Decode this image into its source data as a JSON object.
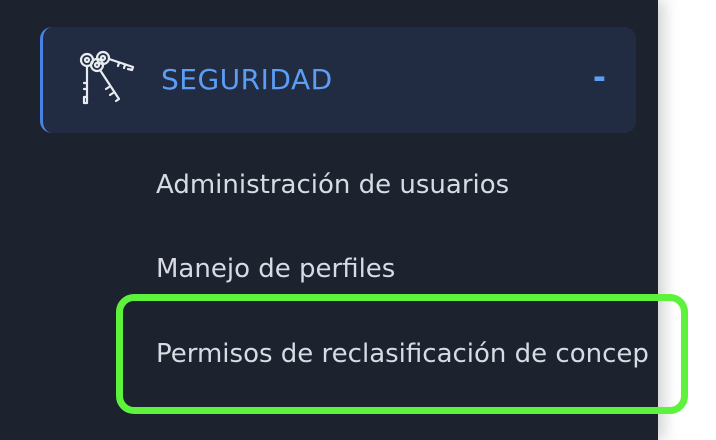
{
  "section": {
    "title": "SEGURIDAD",
    "toggle": "-",
    "icon": "keys-icon"
  },
  "submenu": [
    {
      "label": "Administración de usuarios"
    },
    {
      "label": "Manejo de perfiles"
    },
    {
      "label": "Permisos de reclasificación de concep"
    }
  ],
  "colors": {
    "sidebar_bg": "#1c222e",
    "header_bg": "#212c42",
    "accent": "#5c9ef5",
    "text": "#d7dbe3",
    "highlight": "#5df23c"
  }
}
